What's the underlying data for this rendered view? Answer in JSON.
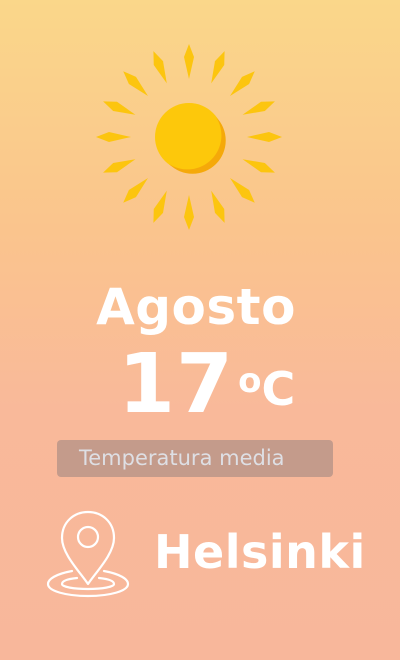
{
  "weather": {
    "month": "Agosto",
    "temperature": "17",
    "unit_degree": "o",
    "unit_letter": "C",
    "subtitle": "Temperatura media",
    "city": "Helsinki",
    "condition_icon": "sun-icon",
    "location_icon": "map-pin-icon"
  },
  "colors": {
    "background_top": "#fad78a",
    "background_bottom": "#f8b79b",
    "sun_core": "#fdc80b",
    "sun_ray": "#fcc50f",
    "text": "#ffffff",
    "subtitle_badge": "#7d7378"
  }
}
